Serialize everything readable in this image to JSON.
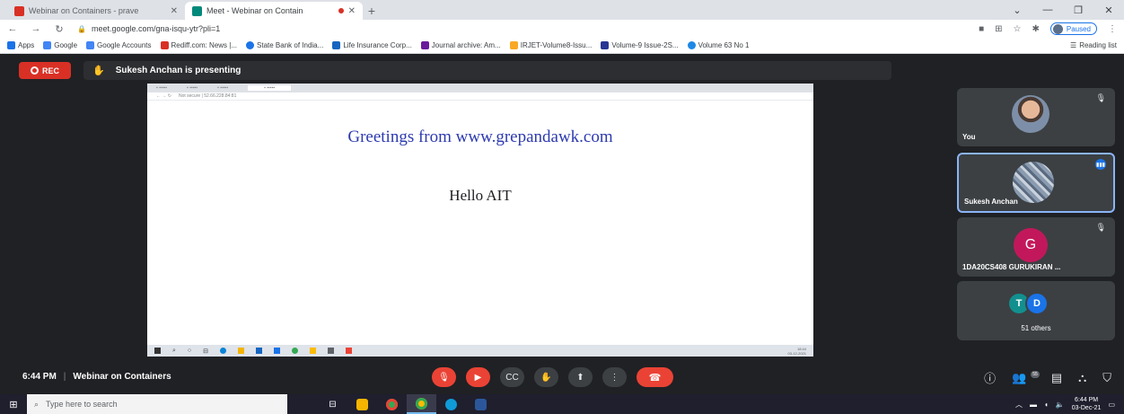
{
  "browser": {
    "tabs": [
      {
        "title": "Webinar on Containers - prave",
        "favicon_color": "#d93025"
      },
      {
        "title": "Meet - Webinar on Contain",
        "favicon_color": "#00897b",
        "active": true
      }
    ],
    "url": "meet.google.com/gna-isqu-ytr?pli=1",
    "profile_label": "Paused",
    "bookmarks": [
      {
        "label": "Apps",
        "color": "#1a73e8"
      },
      {
        "label": "Google",
        "color": "#4285f4"
      },
      {
        "label": "Google Accounts",
        "color": "#4285f4"
      },
      {
        "label": "Rediff.com: News |...",
        "color": "#d93025"
      },
      {
        "label": "State Bank of India...",
        "color": "#1a73e8"
      },
      {
        "label": "Life Insurance Corp...",
        "color": "#1565c0"
      },
      {
        "label": "Journal archive: Am...",
        "color": "#6a1b9a"
      },
      {
        "label": "IRJET-Volume8-Issu...",
        "color": "#f9a825"
      },
      {
        "label": "Volume-9 Issue-2S...",
        "color": "#283593"
      },
      {
        "label": "Volume 63 No 1",
        "color": "#1e88e5"
      }
    ],
    "reading_list": "Reading list"
  },
  "meet": {
    "rec_label": "REC",
    "presenting_text": "Sukesh Anchan is presenting",
    "shared": {
      "greeting": "Greetings from www.grepandawk.com",
      "hello": "Hello AIT",
      "mini_url": "Not secure | 52.66.228.84:81",
      "mini_time": "18:44",
      "mini_date": "03-12-2021"
    },
    "tiles": [
      {
        "name": "You"
      },
      {
        "name": "Sukesh Anchan"
      },
      {
        "name": "1DA20CS408 GURUKIRAN ...",
        "initial": "G"
      },
      {
        "name": "51 others",
        "initials": [
          "T",
          "D"
        ]
      }
    ],
    "time": "6:44 PM",
    "meeting_title": "Webinar on Containers",
    "people_count": "55"
  },
  "taskbar": {
    "search_placeholder": "Type here to search",
    "clock_time": "6:44 PM",
    "clock_date": "03-Dec-21"
  }
}
